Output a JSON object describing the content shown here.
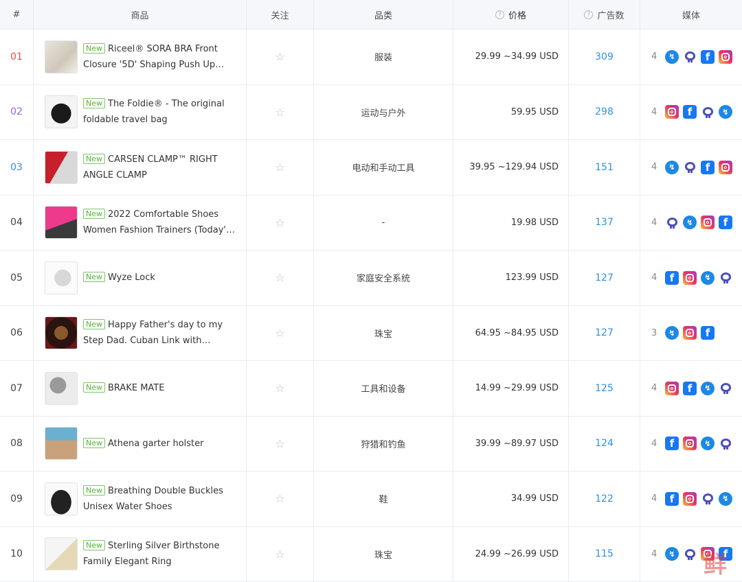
{
  "header": {
    "index": "#",
    "product": "商品",
    "follow": "关注",
    "category": "品类",
    "price": "价格",
    "ads": "广告数",
    "media": "媒体"
  },
  "badge_label": "New",
  "colors": {
    "rank_top1": "#e55048",
    "rank_top2": "#9a62e0",
    "rank_top3": "#3a8bd8",
    "ads_link": "#2f8fe6",
    "new_badge": "#52b335"
  },
  "rows": [
    {
      "idx": "01",
      "title": "Riceel® SORA BRA Front Closure '5D' Shaping Push Up Br…",
      "category": "服装",
      "price": "29.99 ~34.99 USD",
      "ads": "309",
      "media_count": "4",
      "media": [
        "messenger-icon",
        "audience-network-icon",
        "facebook-icon",
        "instagram-icon"
      ]
    },
    {
      "idx": "02",
      "title": "The Foldie® - The original foldable travel bag",
      "category": "运动与户外",
      "price": "59.95 USD",
      "ads": "298",
      "media_count": "4",
      "media": [
        "instagram-icon",
        "facebook-icon",
        "audience-network-icon",
        "messenger-icon"
      ]
    },
    {
      "idx": "03",
      "title": "CARSEN CLAMP™ RIGHT ANGLE CLAMP",
      "category": "电动和手动工具",
      "price": "39.95 ~129.94 USD",
      "ads": "151",
      "media_count": "4",
      "media": [
        "messenger-icon",
        "audience-network-icon",
        "facebook-icon",
        "instagram-icon"
      ]
    },
    {
      "idx": "04",
      "title": "2022 Comfortable Shoes Women Fashion Trainers (Today'…",
      "category": "-",
      "price": "19.98 USD",
      "ads": "137",
      "media_count": "4",
      "media": [
        "audience-network-icon",
        "messenger-icon",
        "instagram-icon",
        "facebook-icon"
      ]
    },
    {
      "idx": "05",
      "title": "Wyze Lock",
      "category": "家庭安全系统",
      "price": "123.99 USD",
      "ads": "127",
      "media_count": "4",
      "media": [
        "facebook-icon",
        "instagram-icon",
        "messenger-icon",
        "audience-network-icon"
      ]
    },
    {
      "idx": "06",
      "title": "Happy Father's day to my Step Dad. Cuban Link with Luxur…",
      "category": "珠宝",
      "price": "64.95 ~84.95 USD",
      "ads": "127",
      "media_count": "3",
      "media": [
        "messenger-icon",
        "instagram-icon",
        "facebook-icon"
      ]
    },
    {
      "idx": "07",
      "title": "BRAKE MATE",
      "category": "工具和设备",
      "price": "14.99 ~29.99 USD",
      "ads": "125",
      "media_count": "4",
      "media": [
        "instagram-icon",
        "facebook-icon",
        "messenger-icon",
        "audience-network-icon"
      ]
    },
    {
      "idx": "08",
      "title": "Athena garter holster",
      "category": "狩猎和钓鱼",
      "price": "39.99 ~89.97 USD",
      "ads": "124",
      "media_count": "4",
      "media": [
        "facebook-icon",
        "instagram-icon",
        "messenger-icon",
        "audience-network-icon"
      ]
    },
    {
      "idx": "09",
      "title": "Breathing Double Buckles Unisex Water Shoes",
      "category": "鞋",
      "price": "34.99 USD",
      "ads": "122",
      "media_count": "4",
      "media": [
        "facebook-icon",
        "instagram-icon",
        "audience-network-icon",
        "messenger-icon"
      ]
    },
    {
      "idx": "10",
      "title": "Sterling Silver Birthstone Family Elegant Ring",
      "category": "珠宝",
      "price": "24.99 ~26.99 USD",
      "ads": "115",
      "media_count": "4",
      "media": [
        "messenger-icon",
        "audience-network-icon",
        "instagram-icon",
        "facebook-icon"
      ]
    }
  ],
  "watermark": "鲜"
}
